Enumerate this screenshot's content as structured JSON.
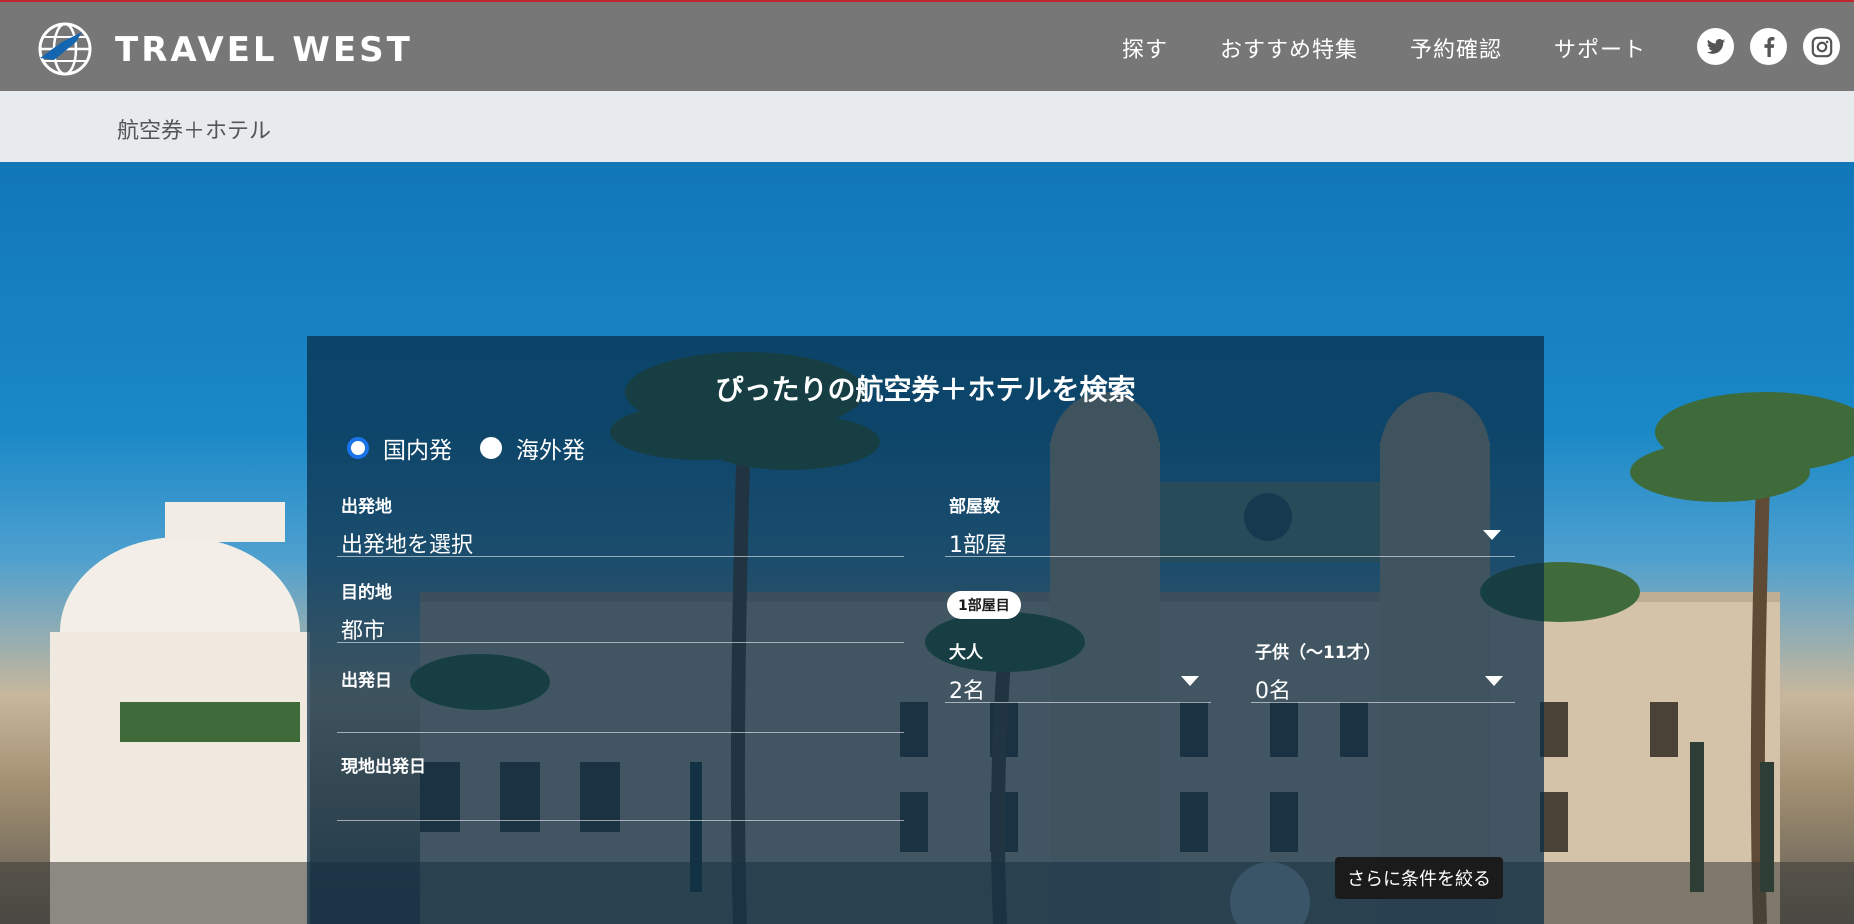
{
  "brand": {
    "name": "TRAVEL WEST",
    "logo_icon": "globe-plane-icon"
  },
  "nav": {
    "items": [
      "探す",
      "おすすめ特集",
      "予約確認",
      "サポート"
    ],
    "social": [
      "twitter-icon",
      "facebook-icon",
      "instagram-icon"
    ]
  },
  "breadcrumb": "航空券＋ホテル",
  "search": {
    "title": "ぴったりの航空券＋ホテルを検索",
    "radio": {
      "domestic": "国内発",
      "overseas": "海外発",
      "selected": "domestic"
    },
    "departure": {
      "label": "出発地",
      "value": "出発地を選択"
    },
    "destination": {
      "label": "目的地",
      "value": "都市"
    },
    "depart_date": {
      "label": "出発日",
      "value": ""
    },
    "local_depart_date": {
      "label": "現地出発日",
      "value": ""
    },
    "rooms": {
      "label": "部屋数",
      "value": "1部屋"
    },
    "room_badge": "1部屋目",
    "adults": {
      "label": "大人",
      "value": "2名"
    },
    "children": {
      "label": "子供（〜11才）",
      "value": "0名"
    },
    "more_button": "さらに条件を絞る"
  },
  "colors": {
    "header": "#777777",
    "accent_red": "#c0262d",
    "radio_active": "#1a73e8",
    "panel": "#082d46"
  }
}
